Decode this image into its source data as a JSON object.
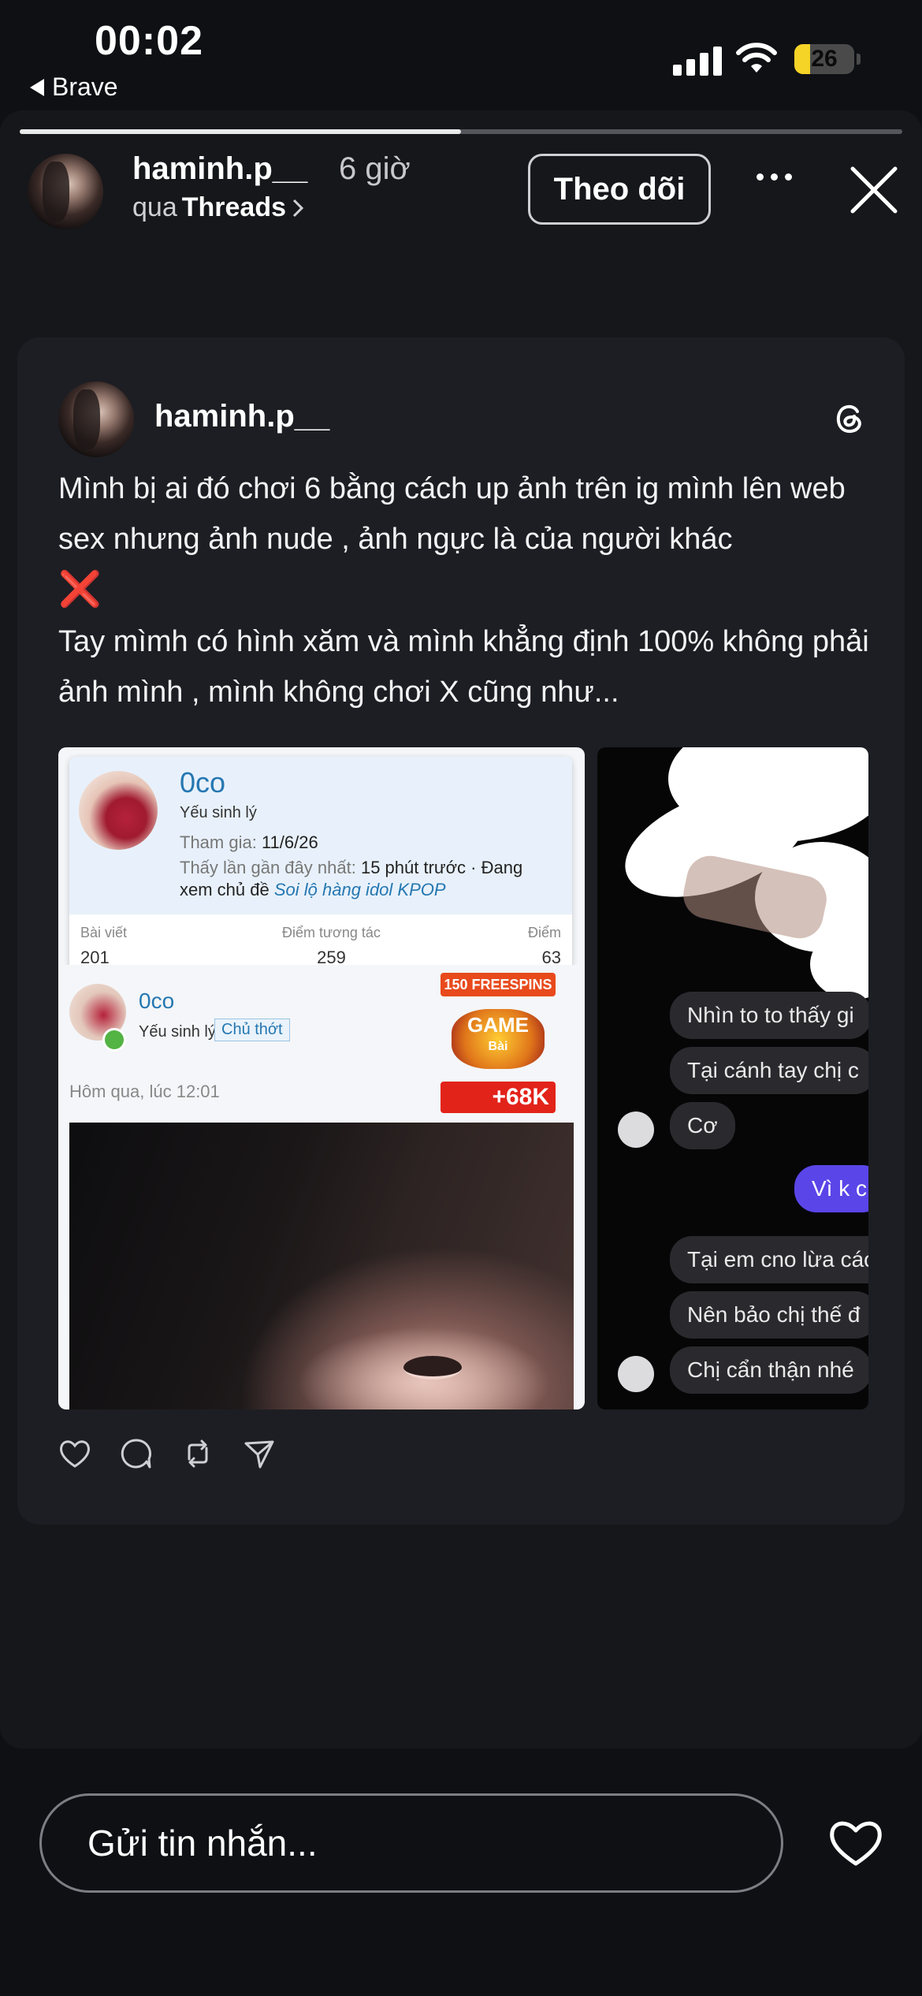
{
  "status_bar": {
    "time": "00:02",
    "back_app": "Brave",
    "battery": "26",
    "battery_level": 0.26
  },
  "story": {
    "progress": 0.5,
    "username": "haminh.p__",
    "time_ago": "6 giờ",
    "via_prefix": "qua",
    "via_app": "Threads",
    "follow_label": "Theo dõi"
  },
  "post": {
    "username": "haminh.p__",
    "text_1": "Mình bị ai đó chơi 6 bằng cách up ảnh trên ig mình lên web sex nhưng ảnh nude , ảnh ngực là của người khác",
    "text_mark": "❌",
    "text_2": "Tay mìmh có hình xăm và mình khẳng định 100% không phải ảnh mình , mình không chơi X cũng như...",
    "image1": {
      "popup_name": "0co",
      "popup_rank": "Yếu sinh lý",
      "joined_label": "Tham gia:",
      "joined_value": "11/6/26",
      "last_seen_label": "Thấy lần gần đây nhất:",
      "last_seen_value": "15 phút trước · Đang",
      "viewing_label": "xem chủ đề",
      "viewing_topic": "Soi lộ hàng idol KPOP",
      "stats": [
        {
          "label": "Bài viết",
          "value": "201"
        },
        {
          "label": "Điểm tương tác",
          "value": "259"
        },
        {
          "label": "Điểm",
          "value": "63"
        }
      ],
      "author_name": "0co",
      "author_rank": "Yếu sinh lý",
      "author_badge": "Chủ thớt",
      "post_date": "Hôm qua, lúc 12:01",
      "ad_top": "150 FREESPINS",
      "ad_game": "GAME",
      "ad_game_sub": "Bài",
      "ad_bottom": "+68K"
    },
    "image2": {
      "messages": [
        {
          "text": "Nhìn to to thấy gi",
          "mine": false
        },
        {
          "text": "Tại cánh tay chị c",
          "mine": false
        },
        {
          "text": "Cơ",
          "mine": false
        },
        {
          "text": "Vì k c",
          "mine": true
        },
        {
          "text": "Tại em cno lừa các",
          "mine": false
        },
        {
          "text": "Nên bảo chị thế đ",
          "mine": false
        },
        {
          "text": "Chị cẩn thận nhé",
          "mine": false
        }
      ]
    }
  },
  "reply": {
    "placeholder": "Gửi tin nhắn..."
  },
  "colors": {
    "background": "#0e1014",
    "card": "#1d1e23",
    "accent_purple": "#5a45e8",
    "link_blue": "#2577b1"
  },
  "icons": [
    "back-icon",
    "signal-icon",
    "wifi-icon",
    "battery-icon",
    "more-icon",
    "close-icon",
    "threads-logo-icon",
    "like-icon",
    "comment-icon",
    "repost-icon",
    "share-icon",
    "heart-icon"
  ]
}
